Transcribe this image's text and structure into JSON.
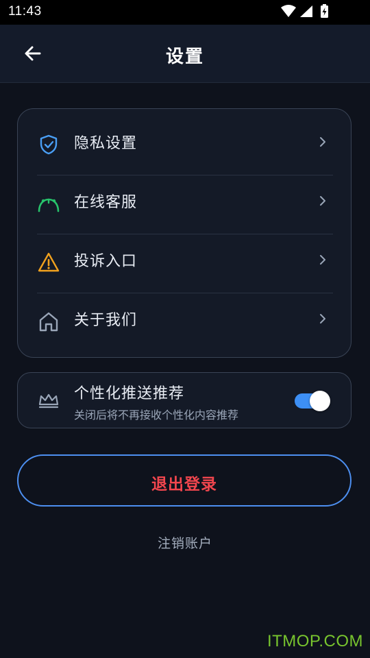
{
  "status_bar": {
    "time": "11:43",
    "icons": [
      "wifi-icon",
      "cellular-signal-icon",
      "battery-charging-icon"
    ]
  },
  "app_bar": {
    "title": "设置",
    "back_icon": "arrow-left-icon"
  },
  "menu": {
    "items": [
      {
        "label": "隐私设置",
        "icon": "shield-check-icon",
        "icon_color": "#4a9ff5"
      },
      {
        "label": "在线客服",
        "icon": "headset-icon",
        "icon_color": "#27c26b"
      },
      {
        "label": "投诉入口",
        "icon": "warning-triangle-icon",
        "icon_color": "#f2a21e"
      },
      {
        "label": "关于我们",
        "icon": "home-icon",
        "icon_color": "#9aa6b8"
      }
    ],
    "chevron_icon": "chevron-right-icon"
  },
  "personalization": {
    "title": "个性化推送推荐",
    "subtitle": "关闭后将不再接收个性化内容推荐",
    "icon": "crown-icon",
    "enabled": true
  },
  "actions": {
    "logout_label": "退出登录",
    "cancel_account_label": "注销账户"
  },
  "watermark": "ITMOP.COM",
  "colors": {
    "background": "#0e121c",
    "card": "#141a27",
    "accent_blue": "#3d8ff5",
    "danger_red": "#f2464e"
  }
}
